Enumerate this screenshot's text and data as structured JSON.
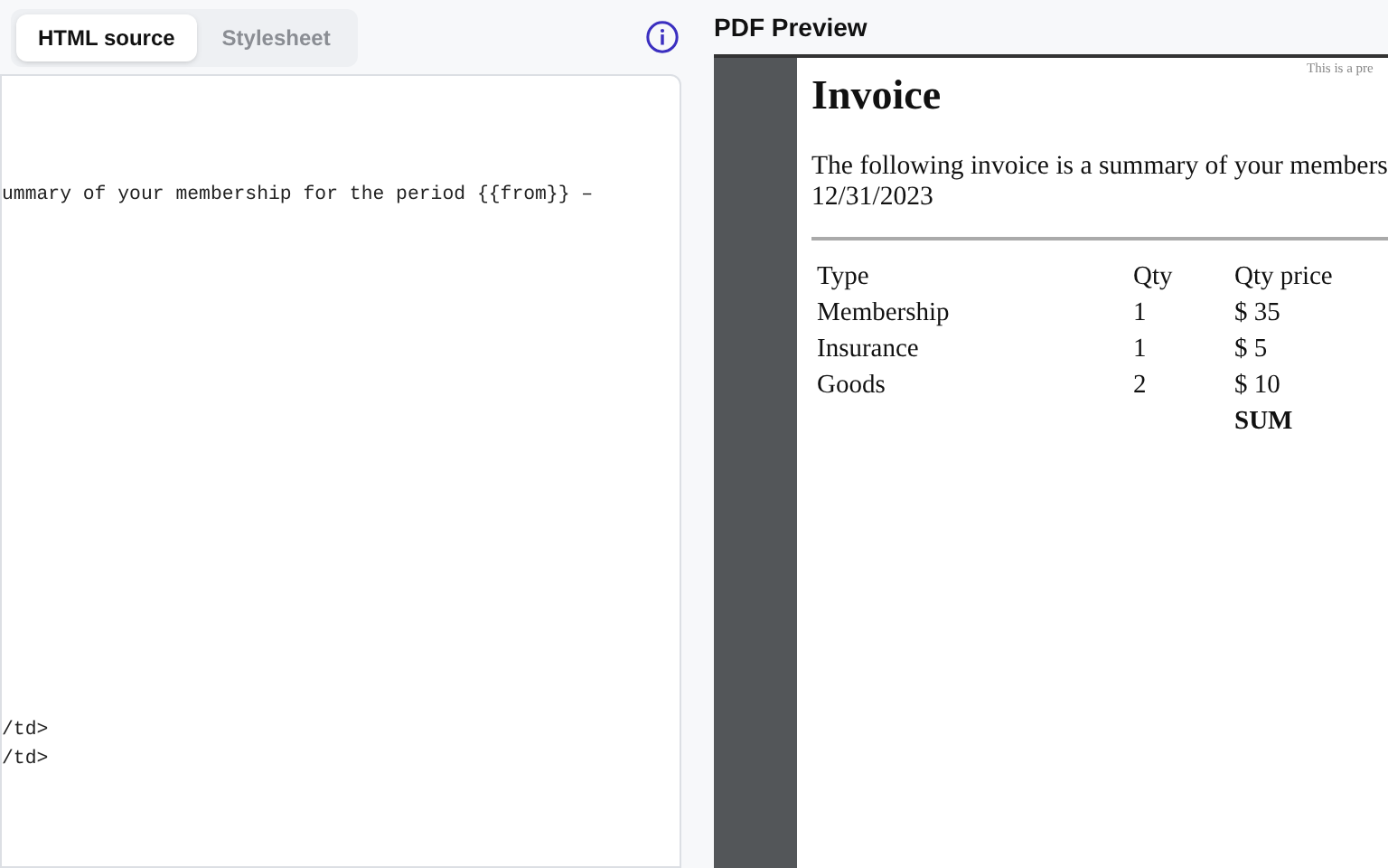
{
  "tabs": [
    {
      "label": "HTML source",
      "selected": true
    },
    {
      "label": "Stylesheet",
      "selected": false
    }
  ],
  "editor": {
    "blocks": [
      [
        "ummary of your membership for the period {{from}} –"
      ],
      [
        "/td>",
        "/td>"
      ]
    ]
  },
  "preview": {
    "title": "PDF Preview",
    "page": {
      "note": "This is a pre",
      "heading": "Invoice",
      "intro_lines": [
        "The following invoice is a summary of your members",
        "12/31/2023"
      ],
      "table": {
        "columns": [
          "Type",
          "Qty",
          "Qty price"
        ],
        "rows": [
          [
            "Membership",
            "1",
            "$ 35"
          ],
          [
            "Insurance",
            "1",
            "$ 5"
          ],
          [
            "Goods",
            "2",
            "$ 10"
          ]
        ],
        "total_label": "SUM"
      }
    }
  }
}
